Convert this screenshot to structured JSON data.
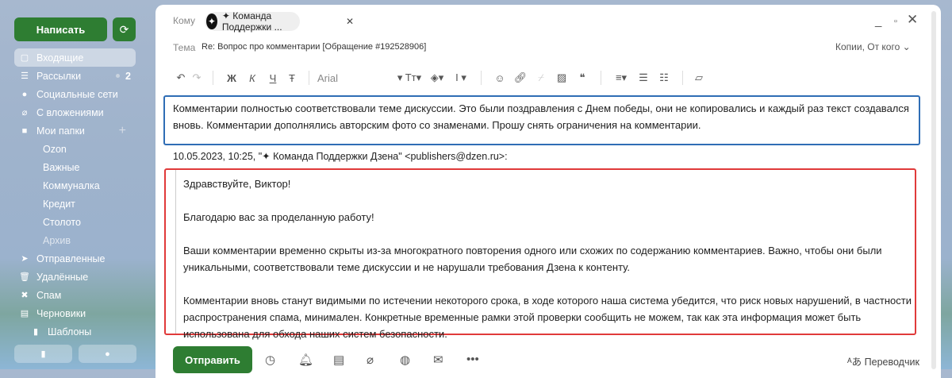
{
  "sidebar": {
    "compose": "Написать",
    "items": [
      {
        "label": "Входящие",
        "icon": "inbox-icon",
        "g": "▢"
      },
      {
        "label": "Рассылки",
        "icon": "newsletter-icon",
        "g": "☰",
        "count": "2"
      },
      {
        "label": "Социальные сети",
        "icon": "chat-icon",
        "g": "●"
      },
      {
        "label": "С вложениями",
        "icon": "paperclip-icon",
        "g": "⌀"
      },
      {
        "label": "Мои папки",
        "icon": "folder-icon",
        "g": "■"
      },
      {
        "label": "Ozon",
        "sub": true
      },
      {
        "label": "Важные",
        "sub": true
      },
      {
        "label": "Коммуналка",
        "sub": true
      },
      {
        "label": "Кредит",
        "sub": true
      },
      {
        "label": "Столото",
        "sub": true
      },
      {
        "label": "Архив",
        "sub": true,
        "dim": true
      },
      {
        "label": "Отправленные",
        "icon": "send-icon",
        "g": "➤"
      },
      {
        "label": "Удалённые",
        "icon": "trash-icon",
        "g": "🗑"
      },
      {
        "label": "Спам",
        "icon": "spam-icon",
        "g": "✖"
      },
      {
        "label": "Черновики",
        "icon": "draft-icon",
        "g": "▤"
      },
      {
        "label": "Шаблоны",
        "icon": "template-icon",
        "g": "▮",
        "sub2": true
      }
    ]
  },
  "compose": {
    "to_label": "Кому",
    "recipient": "✦ Команда Поддержки ...",
    "subject_label": "Тема",
    "subject": "Re: Вопрос про комментарии  [Обращение #192528906]",
    "copies": "Копии, От кого",
    "font": "Arial",
    "body": "Комментарии полностью соответствовали теме дискуссии. Это были поздравления с Днем победы, они не копировались и каждый раз текст создавался вновь. Комментарии дополнялись авторским фото со знаменами. Прошу снять ограничения на комментарии.",
    "quote_meta": "10.05.2023, 10:25, \"✦ Команда Поддержки Дзена\" <publishers@dzen.ru>:",
    "quote": [
      "Здравствуйте, Виктор!",
      "Благодарю вас за проделанную работу!",
      "Ваши комментарии временно скрыты из-за многократного повторения одного или схожих по содержанию комментариев. Важно, чтобы они были уникальными, соответствовали теме дискуссии и не нарушали требования Дзена к контенту.",
      "Комментарии вновь станут видимыми по истечении некоторого срока, в ходе которого наша система убедится, что риск новых нарушений, в частности распространения спама, минимален. Конкретные временные рамки этой проверки сообщить не можем, так как эта информация может быть использована для обхода наших систем безопасности."
    ],
    "send": "Отправить",
    "translator": "Переводчик"
  },
  "colors": {
    "green": "#2e7d32",
    "blue_box": "#2f6db5",
    "red_box": "#e03a3a"
  }
}
